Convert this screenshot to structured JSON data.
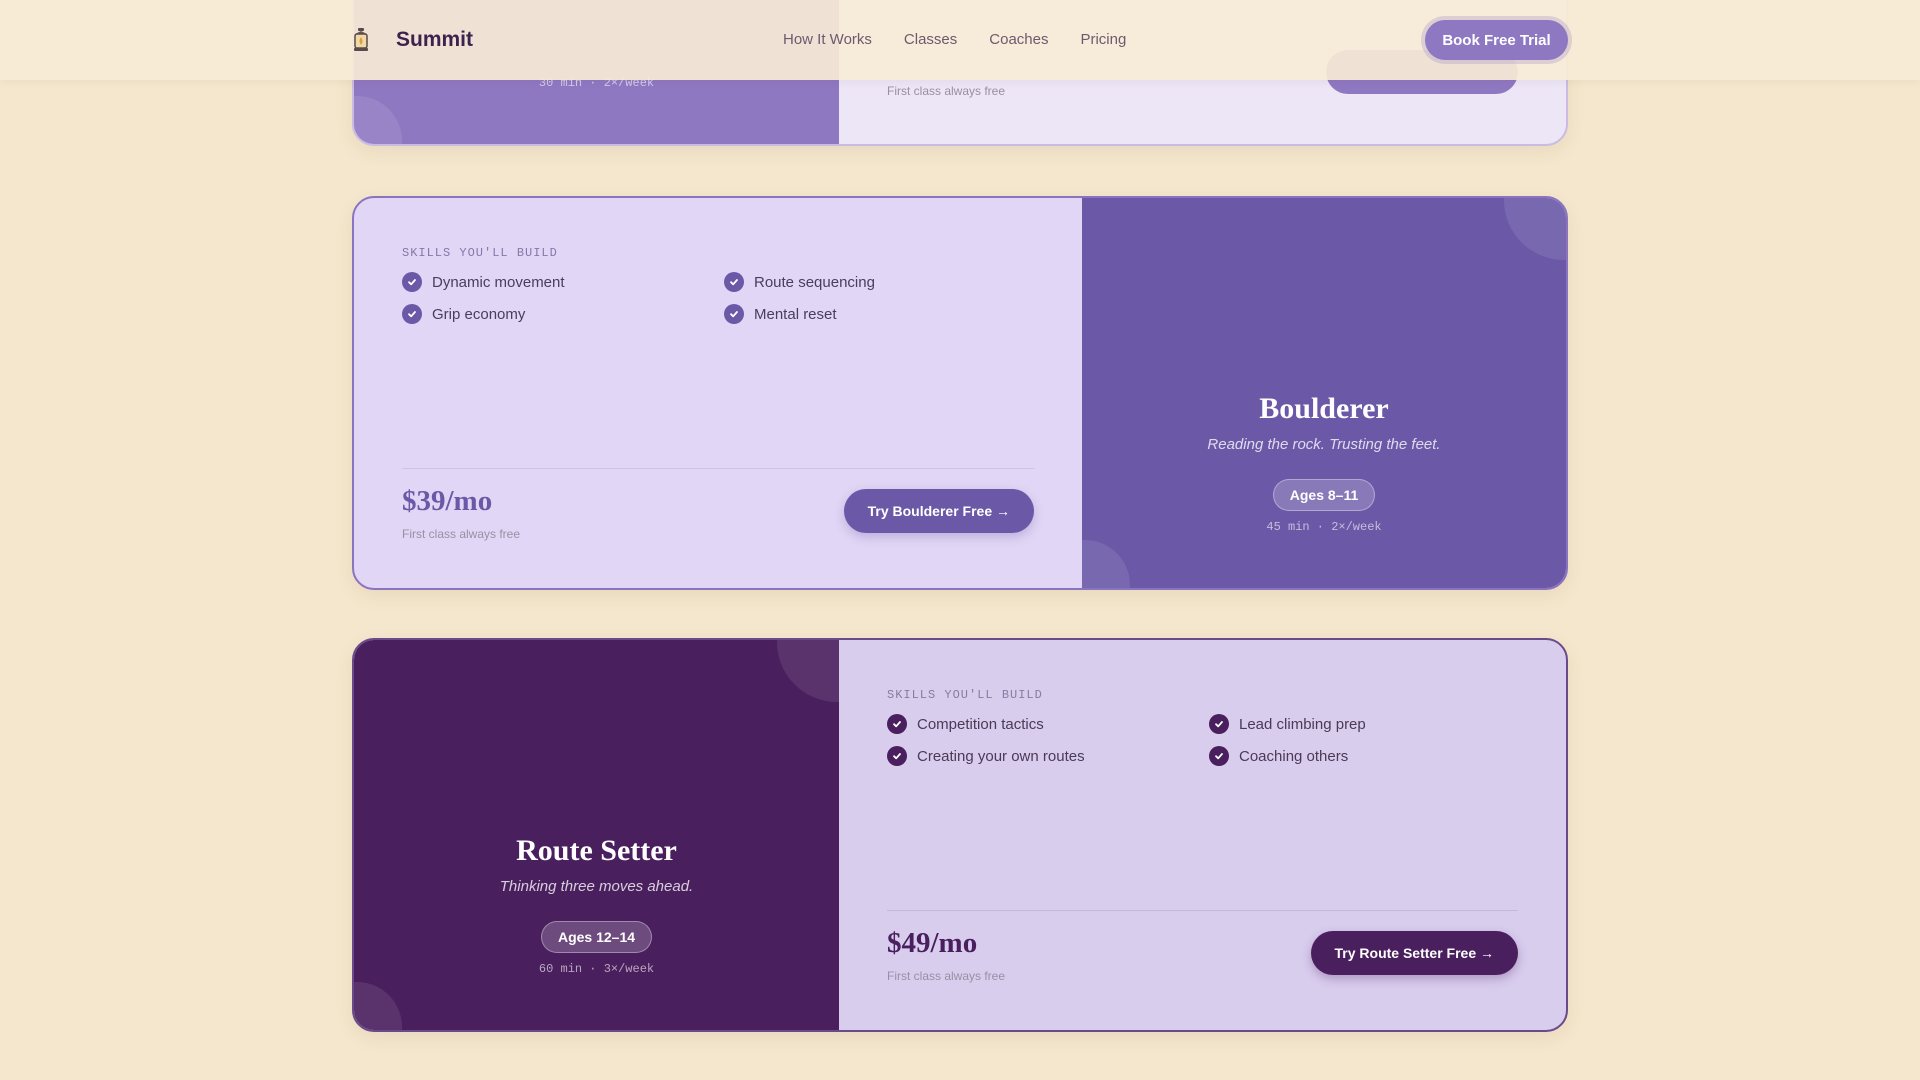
{
  "header": {
    "brand": "Summit",
    "nav": [
      "How It Works",
      "Classes",
      "Coaches",
      "Pricing"
    ],
    "cta": "Book Free Trial"
  },
  "plans": [
    {
      "schedule": "30 min · 2×/week",
      "price_note": "First class always free"
    },
    {
      "title": "Boulderer",
      "tagline": "Reading the rock. Trusting the feet.",
      "ages": "Ages 8–11",
      "schedule": "45 min · 2×/week",
      "skills_label": "SKILLS YOU'LL BUILD",
      "skills": [
        "Dynamic movement",
        "Route sequencing",
        "Grip economy",
        "Mental reset"
      ],
      "price": "$39/mo",
      "price_note": "First class always free",
      "cta": "Try Boulderer Free →"
    },
    {
      "title": "Route Setter",
      "tagline": "Thinking three moves ahead.",
      "ages": "Ages 12–14",
      "schedule": "60 min · 3×/week",
      "skills_label": "SKILLS YOU'LL BUILD",
      "skills": [
        "Competition tactics",
        "Lead climbing prep",
        "Creating your own routes",
        "Coaching others"
      ],
      "price": "$49/mo",
      "price_note": "First class always free",
      "cta": "Try Route Setter Free →"
    }
  ],
  "colors": {
    "page_bg": "#f5e7cd",
    "brand_text": "#3d2250",
    "plan1_accent": "#8f78c2",
    "plan2_accent": "#6b59a8",
    "plan3_accent": "#4a1f5e"
  },
  "icons": [
    "lantern-icon",
    "check-icon"
  ]
}
